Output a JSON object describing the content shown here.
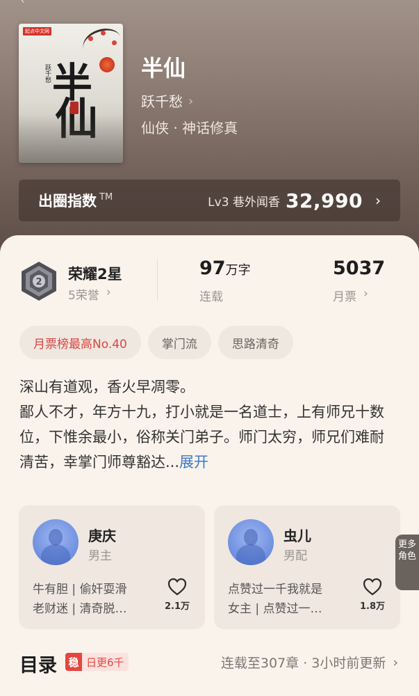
{
  "book": {
    "title": "半仙",
    "author": "跃千愁",
    "genre": "仙侠 · 神话修真",
    "cover": {
      "publisher_badge": "起点中文网",
      "big_text_1": "半",
      "big_text_2": "仙",
      "author_vertical": "跃千愁"
    }
  },
  "index_bar": {
    "label": "出圈指数",
    "tm": "TM",
    "level": "Lv3 巷外闻香",
    "value": "32,990"
  },
  "stats": {
    "honor_title": "荣耀2星",
    "honor_sub": "5荣誉",
    "words_num": "97",
    "words_unit": "万字",
    "words_label": "连载",
    "tickets_num": "5037",
    "tickets_label": "月票"
  },
  "tags": [
    "月票榜最高No.40",
    "掌门流",
    "思路清奇"
  ],
  "description": {
    "line1": "深山有道观，香火早凋零。",
    "rest": "鄙人不才，年方十九，打小就是一名道士，上有师兄十数位，下惟余最小，俗称关门弟子。师门太穷，师兄们难耐清苦，幸掌门师尊豁达...",
    "more": "展开"
  },
  "roles": [
    {
      "name": "庚庆",
      "type": "男主",
      "line1": "牛有胆 | 偷奸耍滑",
      "line2": "老财迷 | 清奇脱…",
      "likes": "2.1万"
    },
    {
      "name": "虫儿",
      "type": "男配",
      "line1": "点赞过一千我就是",
      "line2": "女主 | 点赞过一…",
      "likes": "1.8万"
    }
  ],
  "more_roles": "更多角色",
  "toc": {
    "title": "目录",
    "badge_icon": "稳",
    "badge_text": "日更6千",
    "status": "连载至307章 · 3小时前更新"
  },
  "colors": {
    "accent_red": "#d74943",
    "link_blue": "#3b7ac8"
  }
}
